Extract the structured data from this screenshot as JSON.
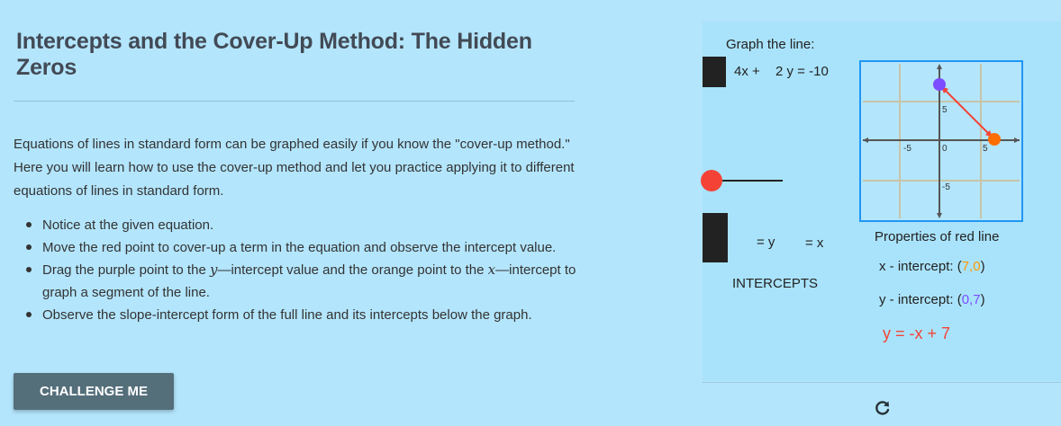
{
  "lesson": {
    "title": "Intercepts and the Cover-Up Method: The Hidden Zeros",
    "intro": "Equations of lines in standard form can be graphed easily if you know the \"cover-up method.\" Here you will learn how to use the cover-up method and let you practice applying it to different equations of lines in standard form.",
    "bullets": [
      {
        "text": "Notice at the given equation."
      },
      {
        "text": "Move the red point to cover-up a term in the equation and observe the intercept value."
      },
      {
        "pre": "Drag the purple point to the ",
        "var1": "y",
        "mid": "—intercept value and the orange point to the ",
        "var2": "x",
        "post": "—intercept to graph a segment of the line."
      },
      {
        "text": "Observe the slope-intercept form of the full line and its intercepts below the graph."
      }
    ],
    "challenge_label": "CHALLENGE ME"
  },
  "panel": {
    "graph_label": "Graph the line:",
    "equation": {
      "a": "4x +",
      "b": "2 y = -10"
    },
    "cover_row": {
      "eq_y": "= y",
      "eq_x": "= x"
    },
    "intercepts_label": "INTERCEPTS",
    "properties_title": "Properties of red line",
    "x_intercept": {
      "label": "x - intercept:",
      "open": "(",
      "value": "7,0",
      "close": ")"
    },
    "y_intercept": {
      "label": "y - intercept:",
      "open": "(",
      "value": "0,7",
      "close": ")"
    },
    "slope_form": "y = -x + 7"
  },
  "graph": {
    "tick_labels": {
      "x_neg": "-5",
      "origin": "0",
      "x_pos": "5",
      "y_pos": "5",
      "y_neg": "-5"
    },
    "colors": {
      "purple": "#7c4dff",
      "orange": "#ff6d00",
      "segment": "#f44336",
      "frame": "#2196f3"
    }
  }
}
